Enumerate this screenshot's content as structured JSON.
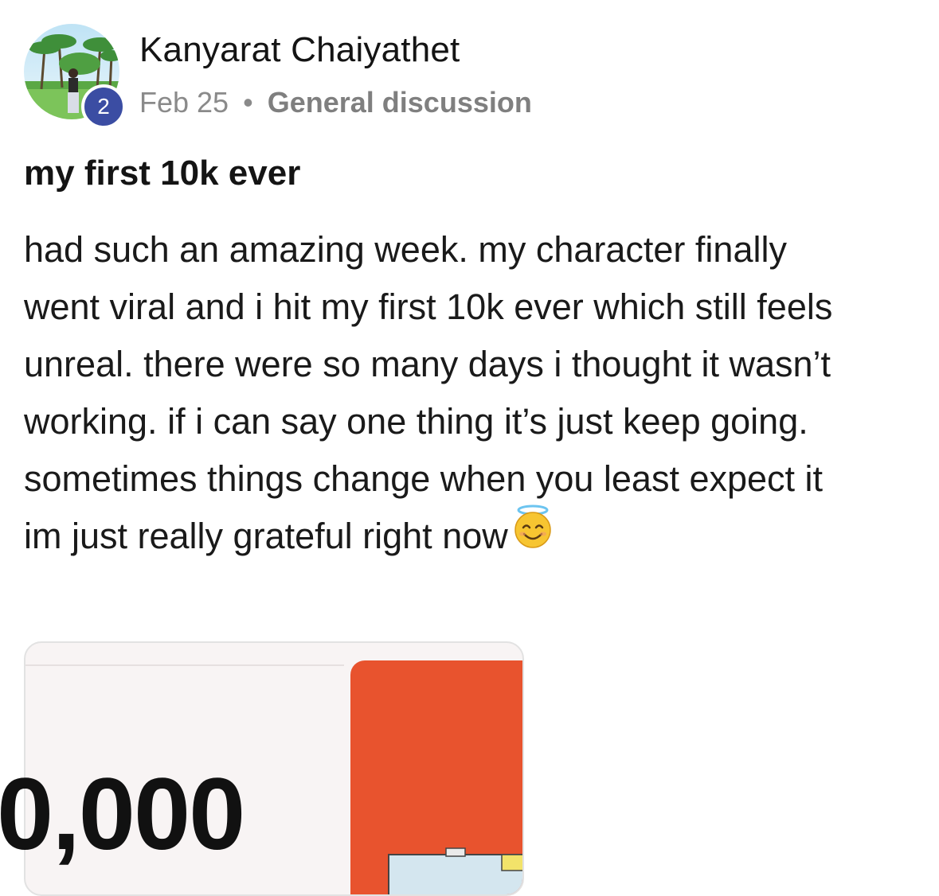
{
  "post": {
    "author": {
      "name": "Kanyarat Chaiyathet",
      "level": "2"
    },
    "date": "Feb 25",
    "separator": "•",
    "category": "General discussion",
    "title": "my first 10k ever",
    "body_lines": [
      "had such an amazing week. my character finally",
      "went viral and i hit my first 10k ever which still feels",
      "unreal. there were so many days i thought it wasn’t",
      "working. if i can say one thing it’s just keep going.",
      "sometimes things change when you least expect it",
      "im just really grateful right now"
    ],
    "emoji": "smiling-face-with-halo",
    "attachment": {
      "amount_text": "0,000"
    }
  },
  "colors": {
    "level_badge": "#3b4da3",
    "attachment_accent": "#e8532e",
    "meta_text": "#8a8a8a"
  }
}
